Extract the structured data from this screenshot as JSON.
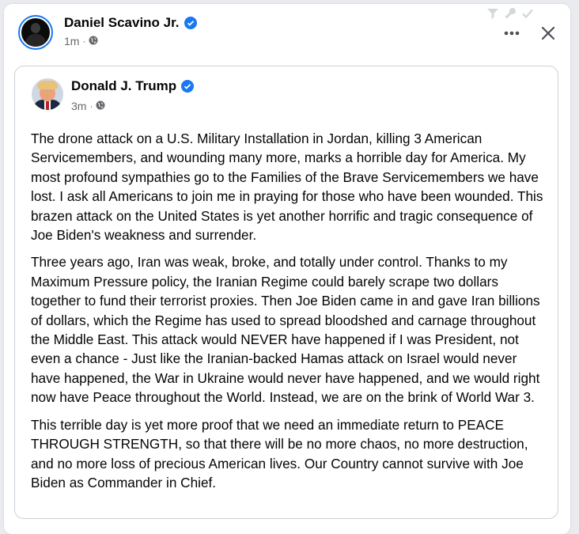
{
  "outer_post": {
    "author": "Daniel Scavino Jr.",
    "time": "1m",
    "separator": "·",
    "privacy_icon": "globe-icon",
    "verified_icon": "verified-badge-icon"
  },
  "actions": {
    "more_icon": "more-options-icon",
    "close_icon": "close-icon"
  },
  "shared_post": {
    "author": "Donald J. Trump",
    "time": "3m",
    "separator": "·",
    "privacy_icon": "globe-icon",
    "paragraphs": [
      "The drone attack on a U.S. Military Installation in Jordan, killing 3 American Servicemembers, and wounding many more, marks a horrible day for America. My most profound sympathies go to the Families of the Brave Servicemembers we have lost. I ask all Americans to join me in praying for those who have been wounded. This brazen attack on the United States is yet another horrific and tragic consequence of Joe Biden's weakness and surrender.",
      "Three years ago, Iran was weak, broke, and totally under control. Thanks to my Maximum Pressure policy, the Iranian Regime could barely scrape two dollars together to fund their terrorist proxies. Then Joe Biden came in and gave Iran billions of dollars, which the Regime has used to spread bloodshed and carnage throughout the Middle East. This attack would NEVER have happened if I was President, not even a chance - Just like the Iranian-backed Hamas attack on Israel would never have happened, the War in Ukraine would never have happened, and we would right now have Peace throughout the World. Instead, we are on the brink of World War 3.",
      "This terrible day is yet more proof that we need an immediate return to PEACE THROUGH STRENGTH, so that there will be no more chaos, no more destruction, and no more loss of precious American lives. Our Country cannot survive with Joe Biden as Commander in Chief."
    ]
  },
  "colors": {
    "accent": "#1877f2",
    "meta_text": "#65676b",
    "text": "#050505",
    "border": "#ced0d4"
  }
}
